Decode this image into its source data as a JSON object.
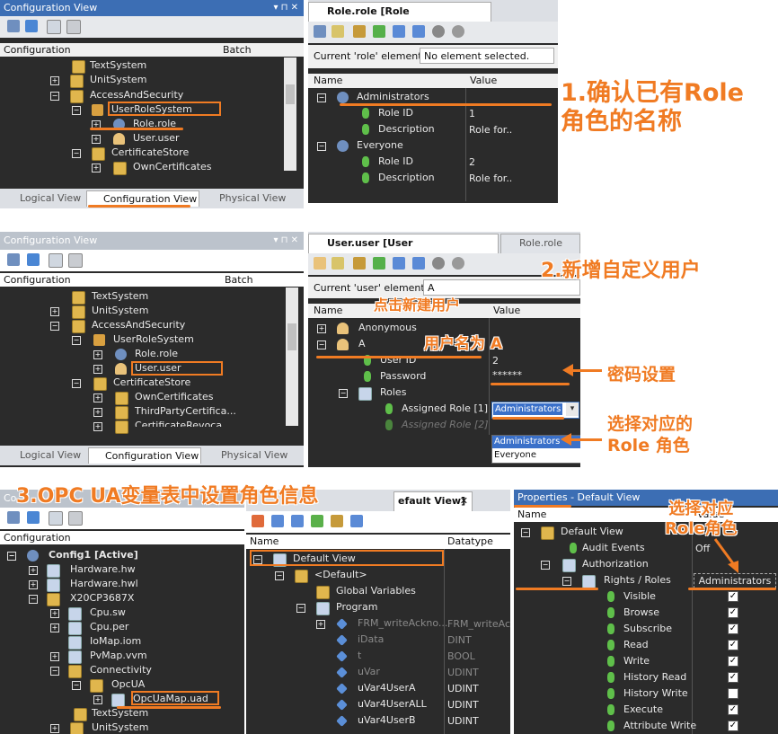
{
  "panel1": {
    "title": "Configuration View",
    "col_config": "Configuration",
    "col_batch": "Batch",
    "items": [
      "TextSystem",
      "UnitSystem",
      "AccessAndSecurity",
      "UserRoleSystem",
      "Role.role",
      "User.user",
      "CertificateStore",
      "OwnCertificates"
    ],
    "tabs": [
      "Logical View",
      "Configuration View",
      "Physical View"
    ]
  },
  "panel2": {
    "tab": "Role.role [Role Configuration]",
    "current_label": "Current 'role' element:",
    "current_value": "No element selected.",
    "col_name": "Name",
    "col_value": "Value",
    "rows": [
      {
        "name": "Administrators",
        "value": ""
      },
      {
        "name": "Role ID",
        "value": "1"
      },
      {
        "name": "Description",
        "value": "Role for.."
      },
      {
        "name": "Everyone",
        "value": ""
      },
      {
        "name": "Role ID",
        "value": "2"
      },
      {
        "name": "Description",
        "value": "Role for.."
      }
    ]
  },
  "annot1": {
    "line1": "1.确认已有Role",
    "line2": "角色的名称"
  },
  "panel3": {
    "title": "Configuration View",
    "col_config": "Configuration",
    "col_batch": "Batch",
    "items": [
      "TextSystem",
      "UnitSystem",
      "AccessAndSecurity",
      "UserRoleSystem",
      "Role.role",
      "User.user",
      "CertificateStore",
      "OwnCertificates",
      "ThirdPartyCertifica...",
      "CertificateRevoca..."
    ],
    "tabs": [
      "Logical View",
      "Configuration View",
      "Physical View"
    ]
  },
  "panel4": {
    "tab_active": "User.user [User Configuration]*",
    "tab_inactive": "Role.role [Ro",
    "current_label": "Current 'user' element:",
    "current_value": "A",
    "col_name": "Name",
    "col_value": "Value",
    "rows": [
      {
        "name": "Anonymous",
        "value": ""
      },
      {
        "name": "A",
        "value": ""
      },
      {
        "name": "User ID",
        "value": "2"
      },
      {
        "name": "Password",
        "value": "******"
      },
      {
        "name": "Roles",
        "value": ""
      },
      {
        "name": "Assigned Role [1]",
        "value": "Administrators"
      },
      {
        "name": "Assigned Role [2]",
        "value": ""
      }
    ],
    "dropdown_options": [
      "Administrators",
      "Everyone"
    ]
  },
  "annot2": {
    "title": "2.新增自定义用户",
    "new_user": "点击新建用户",
    "username": "用户名为 A",
    "password": "密码设置",
    "role_l1": "选择对应的",
    "role_l2": "Role 角色"
  },
  "annot3": {
    "title": "3.OPC UA变量表中设置角色信息",
    "role_l1": "选择对应",
    "role_l2": "Role角色"
  },
  "panel5": {
    "title": "Co",
    "col_config": "Configuration",
    "items": [
      "Config1 [Active]",
      "Hardware.hw",
      "Hardware.hwl",
      "X20CP3687X",
      "Cpu.sw",
      "Cpu.per",
      "IoMap.iom",
      "PvMap.vvm",
      "Connectivity",
      "OpcUA",
      "OpcUaMap.uad",
      "TextSystem",
      "UnitSystem"
    ]
  },
  "panel6": {
    "tab": "efault View]",
    "col_name": "Name",
    "col_type": "Datatype",
    "rows": [
      {
        "name": "Default View",
        "type": ""
      },
      {
        "name": "<Default>",
        "type": ""
      },
      {
        "name": "Global Variables",
        "type": ""
      },
      {
        "name": "Program",
        "type": ""
      },
      {
        "name": "FRM_writeAckno...",
        "type": "FRM_writeAck"
      },
      {
        "name": "iData",
        "type": "DINT"
      },
      {
        "name": "t",
        "type": "BOOL"
      },
      {
        "name": "uVar",
        "type": "UDINT"
      },
      {
        "name": "uVar4UserA",
        "type": "UDINT"
      },
      {
        "name": "uVar4UserALL",
        "type": "UDINT"
      },
      {
        "name": "uVar4UserB",
        "type": "UDINT"
      }
    ]
  },
  "panel7": {
    "title": "Properties - Default View",
    "col_name": "Name",
    "col_value": "Value",
    "rows": [
      {
        "name": "Default View",
        "value": ""
      },
      {
        "name": "Audit Events",
        "value": "Off"
      },
      {
        "name": "Authorization",
        "value": ""
      },
      {
        "name": "Rights / Roles",
        "value": "Administrators"
      },
      {
        "name": "Visible",
        "value": "checked"
      },
      {
        "name": "Browse",
        "value": "checked"
      },
      {
        "name": "Subscribe",
        "value": "checked"
      },
      {
        "name": "Read",
        "value": "checked"
      },
      {
        "name": "Write",
        "value": "checked"
      },
      {
        "name": "History Read",
        "value": "checked"
      },
      {
        "name": "History Write",
        "value": "unchecked"
      },
      {
        "name": "Execute",
        "value": "checked"
      },
      {
        "name": "Attribute Write",
        "value": "checked"
      }
    ]
  },
  "colors": {
    "accent": "#f07b23",
    "dark": "#2b2b2b",
    "title_blue": "#3c6eb4"
  }
}
